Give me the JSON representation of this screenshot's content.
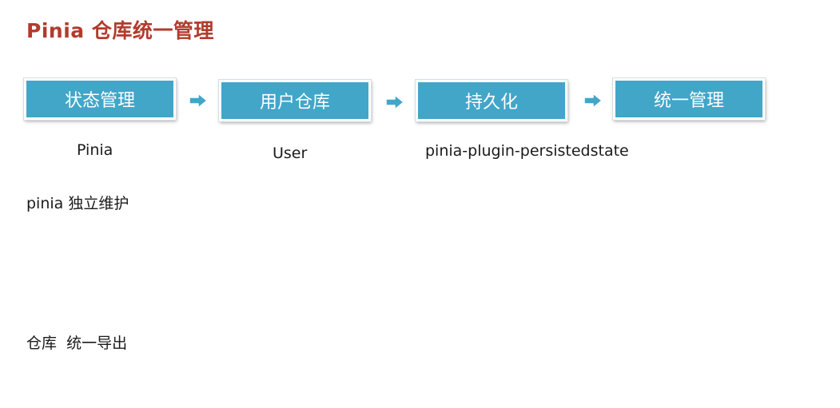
{
  "title": "Pinia 仓库统一管理",
  "flow": {
    "steps": [
      {
        "label": "状态管理",
        "sublabel": "Pinia"
      },
      {
        "label": "用户仓库",
        "sublabel": "User"
      },
      {
        "label": "持久化",
        "sublabel": "pinia-plugin-persistedstate"
      },
      {
        "label": "统一管理",
        "sublabel": ""
      }
    ],
    "box_color": "#42a6c8",
    "arrow_icon": "right-arrow-icon"
  },
  "notes": [
    "pinia 独立维护",
    "仓库  统一导出"
  ],
  "colors": {
    "title": "#b23b2c",
    "box": "#42a6c8",
    "text": "#1a1a1a"
  }
}
